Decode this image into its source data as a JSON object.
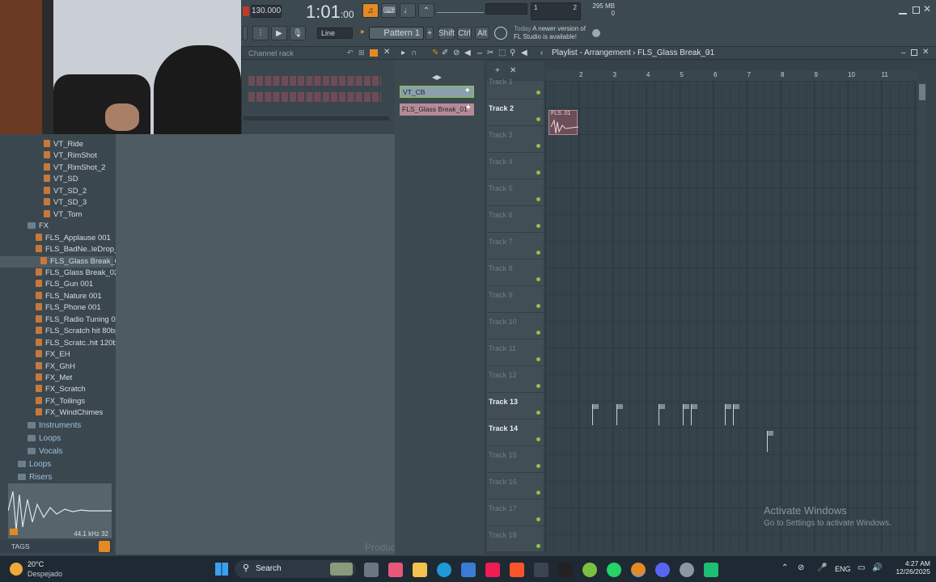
{
  "topbar": {
    "tempo": "130.000",
    "time": "1:01",
    "time_sub": ":00",
    "mode_label": "Line",
    "pattern_label": "Pattern 1",
    "shift": "Shift",
    "ctrl": "Ctrl",
    "alt": "Alt",
    "news_day": "Today",
    "news_text": "A newer version of",
    "news_text2": "FL Studio is available!",
    "cpu_value": "1",
    "poly_value": "2",
    "mem": "295 MB",
    "zero": "0"
  },
  "channel_rack": {
    "title": "Channel rack"
  },
  "playlist": {
    "title": "Playlist - Arrangement",
    "pattern_name": "FLS_Glass Break_01",
    "picker": [
      "VT_CB",
      "FLS_Glass Break_01"
    ],
    "bars": [
      "2",
      "3",
      "4",
      "5",
      "6",
      "7",
      "8",
      "9",
      "10",
      "11"
    ],
    "tracks": [
      "Track 1",
      "Track 2",
      "Track 3",
      "Track 4",
      "Track 5",
      "Track 6",
      "Track 7",
      "Track 8",
      "Track 9",
      "Track 10",
      "Track 11",
      "Track 12",
      "Track 13",
      "Track 14",
      "Track 15",
      "Track 16",
      "Track 17",
      "Track 18"
    ],
    "clip_label": "FLS..01"
  },
  "browser": {
    "items": [
      {
        "label": "VT_Ride",
        "type": "file",
        "indent": 1
      },
      {
        "label": "VT_RimShot",
        "type": "file",
        "indent": 1
      },
      {
        "label": "VT_RimShot_2",
        "type": "file",
        "indent": 1
      },
      {
        "label": "VT_SD",
        "type": "file",
        "indent": 1
      },
      {
        "label": "VT_SD_2",
        "type": "file",
        "indent": 1
      },
      {
        "label": "VT_SD_3",
        "type": "file",
        "indent": 1
      },
      {
        "label": "VT_Tom",
        "type": "file",
        "indent": 1
      },
      {
        "label": "FX",
        "type": "folder",
        "indent": 0
      },
      {
        "label": "FLS_Applause 001",
        "type": "file",
        "indent": 2
      },
      {
        "label": "FLS_BadNe..leDrop_02",
        "type": "file",
        "indent": 2
      },
      {
        "label": "FLS_Glass Break_01",
        "type": "file",
        "indent": 2
      },
      {
        "label": "FLS_Glass Break_02",
        "type": "file",
        "indent": 2
      },
      {
        "label": "FLS_Gun 001",
        "type": "file",
        "indent": 2
      },
      {
        "label": "FLS_Nature 001",
        "type": "file",
        "indent": 2
      },
      {
        "label": "FLS_Phone 001",
        "type": "file",
        "indent": 2
      },
      {
        "label": "FLS_Radio Tuning 001",
        "type": "file",
        "indent": 2
      },
      {
        "label": "FLS_Scratch hit 80bpm",
        "type": "file",
        "indent": 2
      },
      {
        "label": "FLS_Scratc..hit 120bpm",
        "type": "file",
        "indent": 2
      },
      {
        "label": "FX_EH",
        "type": "file",
        "indent": 2
      },
      {
        "label": "FX_GhH",
        "type": "file",
        "indent": 2
      },
      {
        "label": "FX_Met",
        "type": "file",
        "indent": 2
      },
      {
        "label": "FX_Scratch",
        "type": "file",
        "indent": 2
      },
      {
        "label": "FX_Toilings",
        "type": "file",
        "indent": 2
      },
      {
        "label": "FX_WindChimes",
        "type": "file",
        "indent": 2
      }
    ],
    "folders": [
      "Instruments",
      "Loops",
      "Vocals",
      "Loops",
      "Risers"
    ],
    "sample_info": "44.1 kHz 32",
    "tags_label": "TAGS"
  },
  "watermark": {
    "line1": "Activate Windows",
    "line2": "Go to Settings to activate Windows."
  },
  "middle_label": "Produc",
  "taskbar": {
    "temp": "20°C",
    "weather": "Despejado",
    "search": "Search",
    "lang": "ENG",
    "time": "4:27 AM",
    "date": "12/26/2025"
  }
}
